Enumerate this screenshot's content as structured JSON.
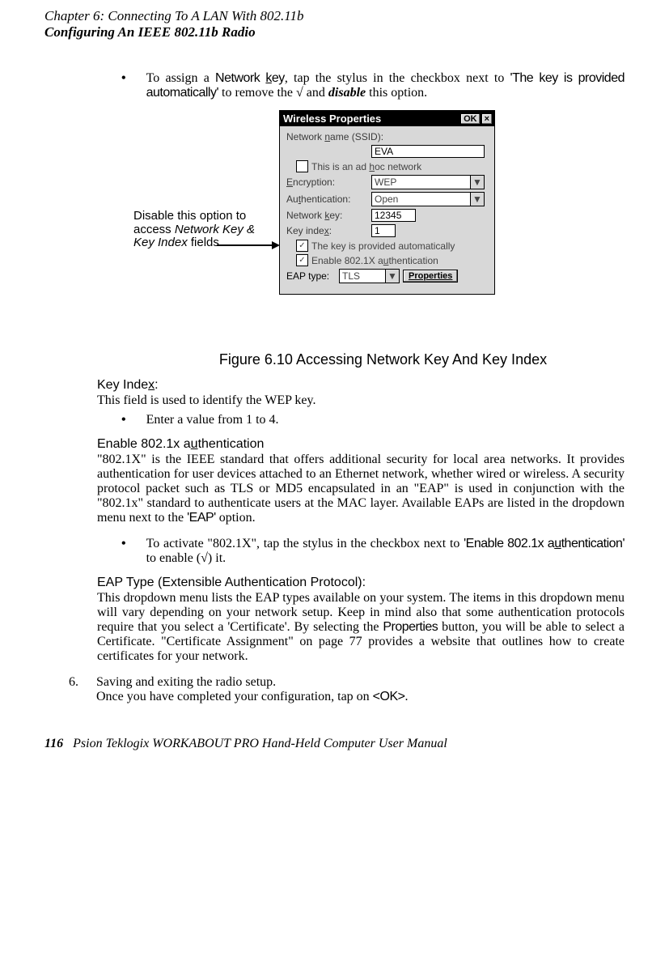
{
  "header": {
    "line1": "Chapter 6: Connecting To A LAN With 802.11b",
    "line2": "Configuring An IEEE 802.11b Radio"
  },
  "bullet1": {
    "pre": "To assign a ",
    "netkey": "Network key",
    "mid1": ", tap the stylus in the checkbox next to ",
    "quote1": "'The key is provided automatically'",
    "mid2": " to remove the √ and ",
    "disable": "disable",
    "post": " this option."
  },
  "annotation": {
    "l1": "Disable this option to",
    "l2_pre": "access ",
    "l2_net": "Network Key &",
    "l3_key": "Key Index",
    "l3_post": " fields."
  },
  "dialog": {
    "title": "Wireless Properties",
    "ok": "OK",
    "close": "×",
    "ssid_label": "Network name (SSID):",
    "ssid_value": "EVA",
    "adhoc_label": "This is an ad hoc network",
    "encryption_label": "Encryption:",
    "encryption_value": "WEP",
    "auth_label": "Authentication:",
    "auth_value": "Open",
    "netkey_label": "Network key:",
    "netkey_value": "12345",
    "keyidx_label": "Key index:",
    "keyidx_value": "1",
    "autokey_label": "The key is provided automatically",
    "enable8021x_label": "Enable 802.1X authentication",
    "eap_label": "EAP type:",
    "eap_value": "TLS",
    "properties_btn": "Properties"
  },
  "figcaption": "Figure 6.10 Accessing Network Key And Key Index",
  "keyindex": {
    "heading": "Key Index:",
    "text": "This field is used to identify the WEP key.",
    "bullet": "Enter a value from 1 to 4."
  },
  "enable8021x": {
    "heading": "Enable 802.1x authentication",
    "text_pre": "\"802.1X\" is the IEEE standard that offers additional security for local area networks. It provides authentication for user devices attached to an Ethernet network, whether wired or wireless. A security protocol packet such as TLS or MD5 encapsulated in an \"EAP\" is used in conjunction with the \"802.1x\" standard to authenticate users at the MAC layer. Available EAPs are listed in the dropdown menu next to the ",
    "eap": "'EAP'",
    "text_post": " option.",
    "bullet_pre": "To activate \"802.1X\", tap the stylus in the checkbox next to ",
    "bullet_q": "'Enable 802.1x authentication'",
    "bullet_post": " to enable (√) it."
  },
  "eaptype": {
    "heading": "EAP Type (Extensible Authentication Protocol):",
    "text_pre": "This dropdown menu lists the EAP types available on your system. The items in this dropdown menu will vary depending on your network setup. Keep in mind also that some authentication protocols require that you select a 'Certificate'. By selecting the ",
    "props": "Properties",
    "text_post": " button, you will be able to select a Certificate. \"Certificate Assignment\" on page 77 provides a website that outlines how to create certificates for your network."
  },
  "step6": {
    "num": "6.",
    "line1": "Saving and exiting the radio setup.",
    "line2_pre": "Once you have completed your configuration, tap on ",
    "ok": "<OK>",
    "line2_post": "."
  },
  "footer": {
    "pagenum": "116",
    "text": "Psion Teklogix WORKABOUT PRO Hand-Held Computer User Manual"
  }
}
